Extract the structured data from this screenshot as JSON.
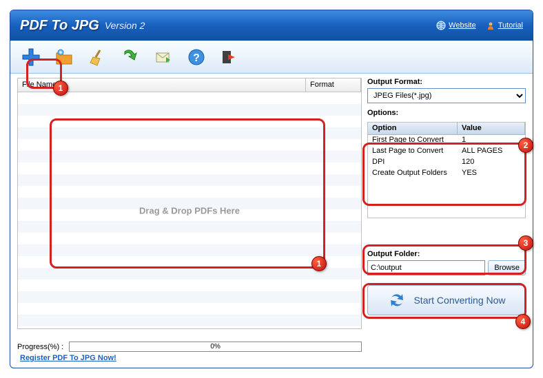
{
  "title": {
    "main": "PDF To JPG",
    "version": "Version 2"
  },
  "titleLinks": {
    "website": "Website",
    "tutorial": "Tutorial"
  },
  "toolbar": {
    "add": "add-file",
    "folder": "open-folder",
    "clean": "clear-list",
    "refresh": "refresh",
    "mail": "mail",
    "help": "help",
    "exit": "exit"
  },
  "fileTable": {
    "colFileName": "File Name",
    "colFormat": "Format",
    "dropHint": "Drag & Drop PDFs Here"
  },
  "progress": {
    "label": "Progress(%)  :",
    "value": "0%"
  },
  "output": {
    "formatLabel": "Output Format:",
    "formatSelected": "JPEG Files(*.jpg)"
  },
  "options": {
    "title": "Options:",
    "colOption": "Option",
    "colValue": "Value",
    "rows": [
      {
        "opt": "First Page to Convert",
        "val": "1"
      },
      {
        "opt": "Last Page to Convert",
        "val": "ALL PAGES"
      },
      {
        "opt": "DPI",
        "val": "120"
      },
      {
        "opt": "Create Output Folders",
        "val": "YES"
      }
    ]
  },
  "folder": {
    "label": "Output Folder:",
    "value": "C:\\output",
    "browse": "Browse"
  },
  "convert": {
    "label": "Start Converting Now"
  },
  "footer": {
    "register": "Register PDF To JPG Now!"
  },
  "badges": {
    "b1": "1",
    "b1b": "1",
    "b2": "2",
    "b3": "3",
    "b4": "4"
  }
}
